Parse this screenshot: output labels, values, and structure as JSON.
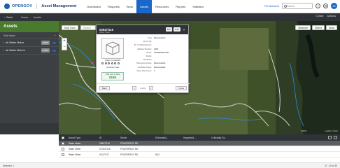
{
  "app": {
    "brand": "OPENGOV",
    "name": "Asset Management"
  },
  "nav": [
    "Dashboard",
    "Requests",
    "Work",
    "Assets",
    "Resources",
    "Reports",
    "Statistics"
  ],
  "nav_active": 3,
  "top": {
    "recent_label": "Re:Network",
    "search_placeholder": "Search",
    "avatar": "JD"
  },
  "sub": {
    "back": "Back",
    "crumbs": [
      "Home",
      "Assets"
    ],
    "create": "Create",
    "actions": "Actions"
  },
  "sidebar": {
    "title": "Assets",
    "section": "Add layer",
    "rows": [
      {
        "label": "all Water Mains",
        "badge": "18806"
      },
      {
        "label": "all Water Meters",
        "badge": "17604"
      }
    ]
  },
  "map": {
    "toolbar": {
      "layers": "Map Tools",
      "search_placeholder": "Search"
    },
    "right_buttons": [
      "Measure",
      "Select",
      "Draw"
    ],
    "zoom": [
      "+",
      "−"
    ],
    "scale": "200 ft",
    "attribution": "Leaflet | © Esri"
  },
  "card": {
    "title": "03647G16",
    "subtitle": "Water Meter",
    "actions": [
      "Edit",
      "Print"
    ],
    "thumb_label": "Image not available",
    "thumb_label2": "Upload an image",
    "cost_label": "Total Cost to Date",
    "cost_value": "$156",
    "fields": [
      {
        "label": "Type",
        "value": "Disconnected"
      },
      {
        "label": "Id (not Id):",
        "value": ""
      },
      {
        "label": "ID: not Manufacturer:",
        "value": ""
      },
      {
        "label": "Address Number:",
        "value": "2330"
      },
      {
        "label": "Street:",
        "value": "POLERFIELD RD"
      },
      {
        "label": "Parcel:",
        "value": ""
      },
      {
        "label": "Replaced:",
        "value": ""
      },
      {
        "label": "Placement Group:",
        "value": "Disconnected"
      },
      {
        "label": "Condition Group:",
        "value": "Disconnected"
      },
      {
        "label": "Open Task Count:",
        "value": "0"
      }
    ],
    "foot": {
      "back": "Back",
      "pager": "1 of 1",
      "close": "Close"
    }
  },
  "grid": {
    "columns": [
      "Asset Type",
      "ID",
      "Street",
      "Estimated...",
      "Inspected...",
      "Criticality Fa..."
    ],
    "rows": [
      [
        "Water Meter",
        "03647G16",
        "POLERFIELD RD",
        "",
        "",
        ""
      ],
      [
        "Water Meter",
        "07G67G16",
        "POLERFIELD RD",
        "",
        "",
        ""
      ],
      [
        "Water Meter",
        "0G47G17",
        "POLERFIELD RD",
        "8/13",
        "",
        ""
      ]
    ]
  },
  "status": {
    "left": "Selected: 1",
    "right": "37 - 39 of 39"
  }
}
